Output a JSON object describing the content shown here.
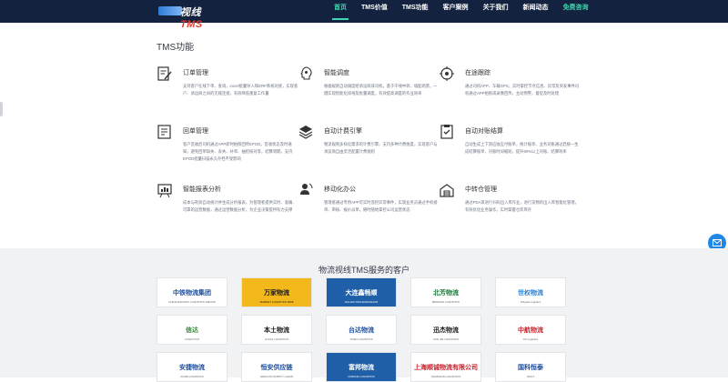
{
  "header": {
    "logo_text_a": "视线",
    "logo_text_b": "TMS",
    "nav": [
      {
        "label": "首页",
        "active": true
      },
      {
        "label": "TMS价值"
      },
      {
        "label": "TMS功能"
      },
      {
        "label": "客户案例"
      },
      {
        "label": "关于我们"
      },
      {
        "label": "新闻动态"
      },
      {
        "label": "免费咨询",
        "highlight": true
      }
    ]
  },
  "features": {
    "title": "TMS功能",
    "items": [
      {
        "icon": "order-edit-icon",
        "title": "订单管理",
        "desc": "支持客户在线下单、查询，excel批量导入和ERP系统对接，实现客户、承运商之间的无缝连接，有效降低重复工作量"
      },
      {
        "icon": "smart-dispatch-icon",
        "title": "智能调度",
        "desc": "根据规则自动调度给承运商或司机，基于干线中转、城配场景，一键实现智能化排线及批量调度，有效提高调度的作业效率"
      },
      {
        "icon": "route-tracking-icon",
        "title": "在途跟踪",
        "desc": "通过司机APP、车载GPS，实时掌控节点信息、异常及突发事件司机通过APP拍照或录像回传，主动预警，督促及时处理"
      },
      {
        "icon": "receipt-icon",
        "title": "回单管理",
        "desc": "客户签收后司机通过APP即时拍照回传EPOD，签收状态及时通知，避免回单缺失、丢失、补单、抽检核对等，结算周期，支持EPOD批量扫描永久存档不受影响"
      },
      {
        "icon": "billing-engine-icon",
        "title": "自动计费引擎",
        "desc": "物流规则多样化需求的计费引擎，支持多种计费维度，实现客户与承运商自由灵活配置计费规则"
      },
      {
        "icon": "auto-settlement-icon",
        "title": "自动对账结算",
        "desc": "自动生成上下游应收应付账单，统计账单、业务对账通过后统一生成结算账单，对账时间缩短，提升90%以上对账、结算效率"
      },
      {
        "icon": "report-analysis-icon",
        "title": "智能报表分析",
        "desc": "成本与利润自动统计并生成分析报表，为管理者提供实时、准确、可靠的运营数据，通过运营数据分析，为企业决策提供有力支撑"
      },
      {
        "icon": "mobile-office-icon",
        "title": "移动化办公",
        "desc": "管理者通过专用APP可实时监控异常事件，实现业务员通过手机接单、审核、报价派单，随时随地掌控公司运营状态"
      },
      {
        "icon": "transit-warehouse-icon",
        "title": "中转仓管理",
        "desc": "通过PDA来进行扫码出入库作业，进行货物的出入库智能化管理，有效优化业务操作，实时掌握仓库库存"
      }
    ]
  },
  "clients": {
    "title": "物流视线TMS服务的客户",
    "logos": [
      {
        "name": "中铁物流集团",
        "sub": "CHINA RAILWAY LOGISTICS GROUP",
        "color": "#1d4fa0",
        "bg": "#ffffff"
      },
      {
        "name": "万家物流",
        "sub": "MARKET LOGISTICS 2008",
        "color": "#1a1a1a",
        "bg": "#f3b81c"
      },
      {
        "name": "大连鑫畅顺",
        "sub": "DALIAN XINCHANGSHUN",
        "color": "#ffffff",
        "bg": "#1e5fa8"
      },
      {
        "name": "北芳物流",
        "sub": "BEIFANG LOGISTICS",
        "color": "#1b7a3c",
        "bg": "#ffffff"
      },
      {
        "name": "世权物流",
        "sub": "Shiquan logistics",
        "color": "#2b7fd4",
        "bg": "#ffffff"
      },
      {
        "name": "信达",
        "sub": "LOGISTICS",
        "color": "#3b8a3b",
        "bg": "#ffffff"
      },
      {
        "name": "本土物流",
        "sub": "LOCAL LOGISTICS",
        "color": "#1a1a1a",
        "bg": "#ffffff"
      },
      {
        "name": "台达物流",
        "sub": "TAIDA LOGISTICS",
        "color": "#1d4fa0",
        "bg": "#ffffff"
      },
      {
        "name": "迅杰物流",
        "sub": "XUN JIE LOGISTICS",
        "color": "#1a1a1a",
        "bg": "#ffffff"
      },
      {
        "name": "中航物流",
        "sub": "CA Logistics",
        "color": "#c8202b",
        "bg": "#ffffff"
      },
      {
        "name": "安捷物流",
        "sub": "ANJIE LOGISTICS",
        "color": "#1d4fa0",
        "bg": "#ffffff"
      },
      {
        "name": "恒安供应链",
        "sub": "HENG'AN SUPPLY CHAIN",
        "color": "#1d4fa0",
        "bg": "#ffffff"
      },
      {
        "name": "富邦物流",
        "sub": "FUBANG LOGISTICS",
        "color": "#ffffff",
        "bg": "#1e5fa8"
      },
      {
        "name": "上海顺诚物流有限公司",
        "sub": "SHANGHAI LOGISTICS",
        "color": "#c8202b",
        "bg": "#ffffff"
      },
      {
        "name": "国科恒泰",
        "sub": "GKHT",
        "color": "#1d4fa0",
        "bg": "#ffffff"
      }
    ]
  },
  "colors": {
    "topbar": "#13233f",
    "accent": "#3fd7b2",
    "float_button": "#1f88e5"
  }
}
